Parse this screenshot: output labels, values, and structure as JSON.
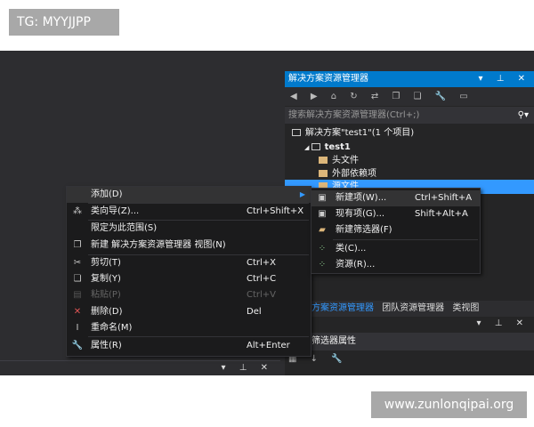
{
  "overlay_tag": "TG: MYYJJPP",
  "watermark": "www.zunlonqipai.org",
  "solution_explorer": {
    "title": "解决方案资源管理器",
    "title_icons": "▾ ⊥ ✕",
    "toolbar_icons": "◀ ▶ ⌂ ↻ ⇄ ❐ ❏ 🔧 ▭",
    "search_placeholder": "搜索解决方案资源管理器(Ctrl+;)",
    "tree": [
      {
        "label": "解决方案\"test1\"(1 个项目)",
        "icon": "solution-icon"
      },
      {
        "label": "test1",
        "icon": "project-icon",
        "expanded": true
      },
      {
        "label": "头文件",
        "icon": "folder-icon"
      },
      {
        "label": "外部依赖项",
        "icon": "folder-icon"
      },
      {
        "label": "源文件",
        "icon": "folder-icon",
        "selected": true
      }
    ]
  },
  "tabs": [
    {
      "label": "方案资源管理器",
      "active": true
    },
    {
      "label": "团队资源管理器"
    },
    {
      "label": "类视图"
    }
  ],
  "properties": {
    "title_icons": "▾ ⊥ ✕",
    "header": "筛选器属性",
    "toolbar_icons": "▦ ↓ 🔧"
  },
  "bottom_panel": {
    "title_icons": "▾ ⊥ ✕"
  },
  "context_menu": [
    {
      "label": "添加(D)",
      "shortcut": "",
      "icon": "",
      "submenu": true
    },
    {
      "label": "类向导(Z)...",
      "shortcut": "Ctrl+Shift+X",
      "icon": "class-wizard-icon"
    },
    {
      "label": "限定为此范围(S)",
      "shortcut": "",
      "icon": ""
    },
    {
      "label": "新建 解决方案资源管理器 视图(N)",
      "shortcut": "",
      "icon": "new-view-icon"
    },
    {
      "label": "剪切(T)",
      "shortcut": "Ctrl+X",
      "icon": "cut-icon"
    },
    {
      "label": "复制(Y)",
      "shortcut": "Ctrl+C",
      "icon": "copy-icon"
    },
    {
      "label": "粘贴(P)",
      "shortcut": "Ctrl+V",
      "icon": "paste-icon",
      "disabled": true
    },
    {
      "label": "删除(D)",
      "shortcut": "Del",
      "icon": "delete-icon"
    },
    {
      "label": "重命名(M)",
      "shortcut": "",
      "icon": "rename-icon"
    },
    {
      "label": "属性(R)",
      "shortcut": "Alt+Enter",
      "icon": "wrench-icon"
    }
  ],
  "submenu": [
    {
      "label": "新建项(W)...",
      "shortcut": "Ctrl+Shift+A",
      "icon": "new-item-icon"
    },
    {
      "label": "现有项(G)...",
      "shortcut": "Shift+Alt+A",
      "icon": "existing-item-icon"
    },
    {
      "label": "新建筛选器(F)",
      "shortcut": "",
      "icon": "new-filter-icon"
    },
    {
      "label": "类(C)...",
      "shortcut": "",
      "icon": "class-icon"
    },
    {
      "label": "资源(R)...",
      "shortcut": "",
      "icon": "resource-icon"
    }
  ],
  "colors": {
    "accent": "#007acc",
    "selection": "#3399ff",
    "delete": "#e05555"
  }
}
